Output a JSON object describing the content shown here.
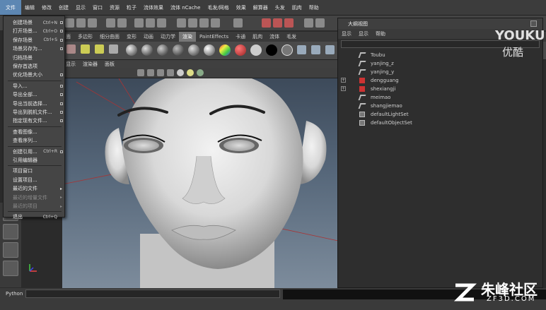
{
  "menubar": {
    "items": [
      "文件",
      "编辑",
      "修改",
      "创建",
      "显示",
      "窗口",
      "资源",
      "粒子",
      "流体效果",
      "流体 nCache",
      "毛发/网格",
      "效果",
      "解算器",
      "头发",
      "肌肉",
      "帮助"
    ]
  },
  "shelf_tabs": [
    "面",
    "多边形",
    "细分曲面",
    "变形",
    "动画",
    "动力学",
    "渲染",
    "PaintEffects",
    "卡通",
    "肌肉",
    "流体",
    "毛发"
  ],
  "shelf_active_index": 6,
  "view_menu": [
    "显示",
    "渲染器",
    "面板"
  ],
  "file_menu": {
    "items": [
      {
        "label": "创建场景",
        "shortcut": "Ctrl+N",
        "option": true
      },
      {
        "label": "打开场景...",
        "shortcut": "Ctrl+O",
        "option": true
      },
      {
        "label": "保存场景",
        "shortcut": "Ctrl+S",
        "option": true
      },
      {
        "label": "场景另存为...",
        "shortcut": "",
        "option": true
      },
      {
        "label": "归档场景",
        "shortcut": "",
        "option": false
      },
      {
        "label": "保存首选项",
        "shortcut": "",
        "option": false
      },
      {
        "label": "优化场景大小",
        "shortcut": "",
        "option": true
      },
      {
        "label": "导入...",
        "shortcut": "",
        "option": true
      },
      {
        "label": "导出全部...",
        "shortcut": "",
        "option": true
      },
      {
        "label": "导出当前选择...",
        "shortcut": "",
        "option": true
      },
      {
        "label": "导出到脱机文件...",
        "shortcut": "",
        "option": true
      },
      {
        "label": "指定现有文件...",
        "shortcut": "",
        "option": true
      },
      {
        "label": "查看图像...",
        "shortcut": "",
        "option": false
      },
      {
        "label": "查看序列...",
        "shortcut": "",
        "option": false
      },
      {
        "label": "创建引用...",
        "shortcut": "Ctrl+R",
        "option": true
      },
      {
        "label": "引用编辑器",
        "shortcut": "",
        "option": false
      },
      {
        "label": "项目窗口",
        "shortcut": "",
        "option": false
      },
      {
        "label": "设置项目...",
        "shortcut": "",
        "option": false
      },
      {
        "label": "最近的文件",
        "shortcut": "",
        "option": false,
        "submenu": true
      },
      {
        "label": "最近的增量文件",
        "shortcut": "",
        "option": false,
        "submenu": true,
        "disabled": true
      },
      {
        "label": "最近的项目",
        "shortcut": "",
        "option": false,
        "submenu": true,
        "disabled": true
      },
      {
        "label": "退出",
        "shortcut": "Ctrl+Q",
        "option": false
      }
    ]
  },
  "outliner": {
    "title": "大纲视图",
    "menu": [
      "显示",
      "显示",
      "帮助"
    ],
    "rows": [
      {
        "label": "Toubu",
        "expandable": false,
        "kind": "mesh"
      },
      {
        "label": "yanjing_z",
        "expandable": false,
        "kind": "mesh"
      },
      {
        "label": "yanjing_y",
        "expandable": false,
        "kind": "mesh"
      },
      {
        "label": "dengguang",
        "expandable": true,
        "kind": "light"
      },
      {
        "label": "shexiangji",
        "expandable": true,
        "kind": "light"
      },
      {
        "label": "meimao",
        "expandable": false,
        "kind": "mesh"
      },
      {
        "label": "shangjiemao",
        "expandable": false,
        "kind": "mesh"
      },
      {
        "label": "defaultLightSet",
        "expandable": false,
        "kind": "set"
      },
      {
        "label": "defaultObjectSet",
        "expandable": false,
        "kind": "set"
      }
    ]
  },
  "command_line": {
    "label": "Python"
  },
  "watermarks": {
    "youku": "YOUKU",
    "youku_cn": "优酷",
    "zf_cn": "朱峰社区",
    "zf_url": "ZF3D.COM"
  },
  "colors": {
    "menu_highlight": "#5d87b3",
    "active_tab": "#777777",
    "viewport_top": "#3d4a5a",
    "viewport_bottom": "#7d8c9c"
  }
}
